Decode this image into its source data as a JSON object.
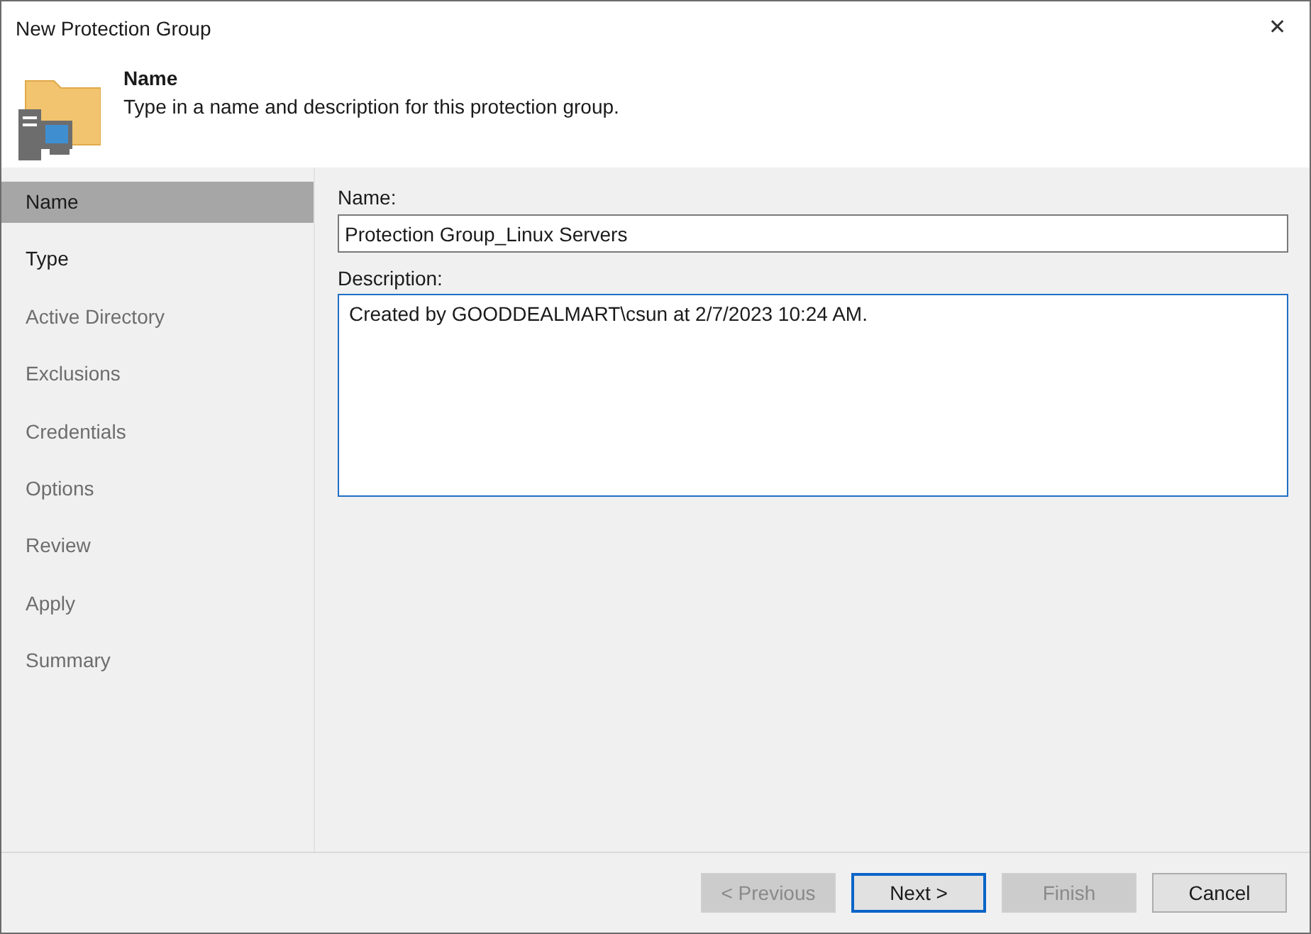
{
  "window": {
    "title": "New Protection Group",
    "close": "✕"
  },
  "header": {
    "title": "Name",
    "subtitle": "Type in a name and description for this protection group."
  },
  "steps": [
    {
      "label": "Name",
      "selected": true,
      "disabled": false
    },
    {
      "label": "Type",
      "selected": false,
      "disabled": false
    },
    {
      "label": "Active Directory",
      "selected": false,
      "disabled": true
    },
    {
      "label": "Exclusions",
      "selected": false,
      "disabled": true
    },
    {
      "label": "Credentials",
      "selected": false,
      "disabled": true
    },
    {
      "label": "Options",
      "selected": false,
      "disabled": true
    },
    {
      "label": "Review",
      "selected": false,
      "disabled": true
    },
    {
      "label": "Apply",
      "selected": false,
      "disabled": true
    },
    {
      "label": "Summary",
      "selected": false,
      "disabled": true
    }
  ],
  "form": {
    "name_label": "Name:",
    "name_value": "Protection Group_Linux Servers",
    "description_label": "Description:",
    "description_value": "Created by GOODDEALMART\\csun at 2/7/2023 10:24 AM."
  },
  "buttons": [
    {
      "label": "< Previous",
      "disabled": true,
      "focused": false
    },
    {
      "label": "Next >",
      "disabled": false,
      "focused": true
    },
    {
      "label": "Finish",
      "disabled": true,
      "focused": false
    },
    {
      "label": "Cancel",
      "disabled": false,
      "focused": false
    }
  ]
}
